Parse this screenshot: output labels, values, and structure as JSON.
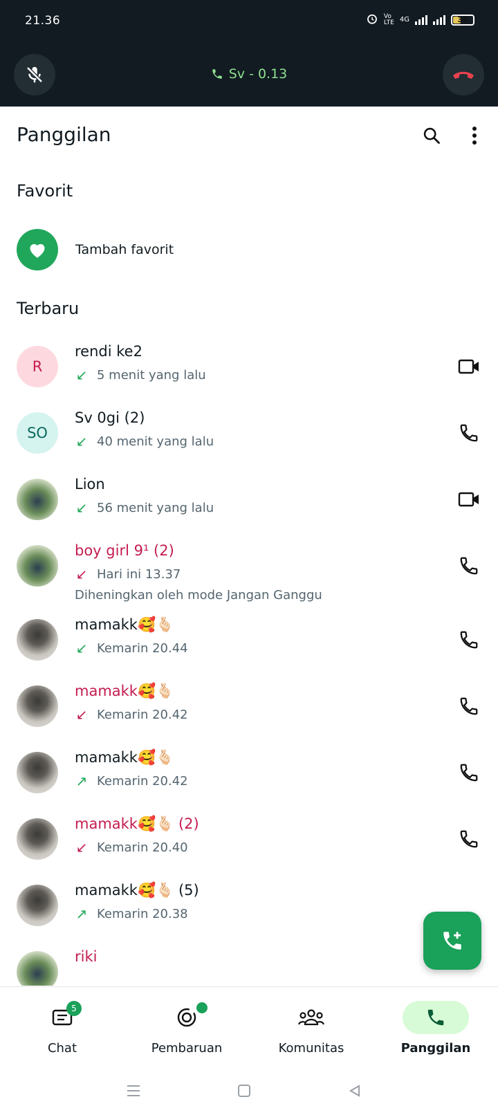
{
  "status_bar": {
    "time": "21.36",
    "battery": "38",
    "network": "4G"
  },
  "ongoing_call": {
    "label": "Sv - 0.13"
  },
  "header": {
    "title": "Panggilan"
  },
  "favorites": {
    "title": "Favorit",
    "add_label": "Tambah favorit"
  },
  "recent": {
    "title": "Terbaru",
    "items": [
      {
        "name": "rendi ke2",
        "initials": "R",
        "time": "5 menit yang lalu",
        "direction": "incoming",
        "missed": false,
        "type": "video"
      },
      {
        "name": "Sv 0gi (2)",
        "initials": "SO",
        "time": "40 menit yang lalu",
        "direction": "incoming",
        "missed": false,
        "type": "voice"
      },
      {
        "name": "Lion",
        "initials": "",
        "time": "56 menit yang lalu",
        "direction": "incoming",
        "missed": false,
        "type": "video"
      },
      {
        "name": "boy girl 9¹ (2)",
        "initials": "",
        "time": "Hari ini 13.37",
        "note": "Diheningkan oleh mode Jangan Ganggu",
        "direction": "incoming",
        "missed": true,
        "type": "voice"
      },
      {
        "name": "mamakk🥰🫰🏻",
        "initials": "",
        "time": "Kemarin 20.44",
        "direction": "incoming",
        "missed": false,
        "type": "voice"
      },
      {
        "name": "mamakk🥰🫰🏻",
        "initials": "",
        "time": "Kemarin 20.42",
        "direction": "incoming",
        "missed": true,
        "type": "voice"
      },
      {
        "name": "mamakk🥰🫰🏻",
        "initials": "",
        "time": "Kemarin 20.42",
        "direction": "outgoing",
        "missed": false,
        "type": "voice"
      },
      {
        "name": "mamakk🥰🫰🏻 (2)",
        "initials": "",
        "time": "Kemarin 20.40",
        "direction": "incoming",
        "missed": true,
        "type": "voice"
      },
      {
        "name": "mamakk🥰🫰🏻 (5)",
        "initials": "",
        "time": "Kemarin 20.38",
        "direction": "outgoing",
        "missed": false,
        "type": "voice"
      },
      {
        "name": "riki",
        "initials": "",
        "time": "",
        "direction": "incoming",
        "missed": true,
        "type": "voice"
      }
    ]
  },
  "bottom_nav": {
    "items": [
      {
        "label": "Chat",
        "badge": "5"
      },
      {
        "label": "Pembaruan"
      },
      {
        "label": "Komunitas"
      },
      {
        "label": "Panggilan"
      }
    ]
  },
  "colors": {
    "accent": "#1aa15a",
    "missed": "#c41d4f",
    "call_bar": "#121b22",
    "active_pill": "#d7fbd6"
  }
}
